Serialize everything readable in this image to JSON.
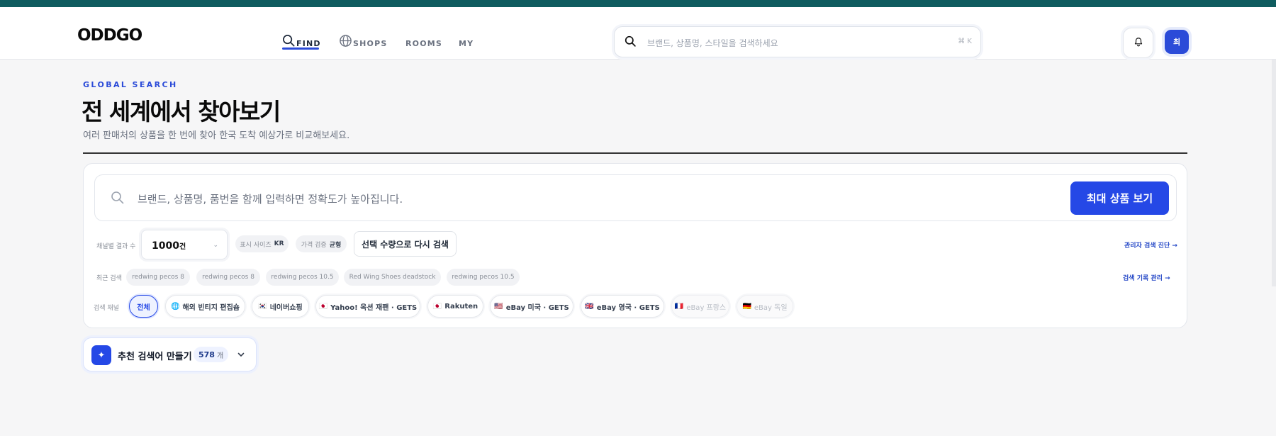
{
  "header": {
    "logo": "ODDGO",
    "nav": [
      {
        "label": "FIND",
        "icon": "search-icon",
        "active": true
      },
      {
        "label": "SHOPS",
        "icon": "globe-icon",
        "active": false
      },
      {
        "label": "ROOMS",
        "active": false
      },
      {
        "label": "MY",
        "active": false
      }
    ],
    "search_placeholder": "브랜드, 상품명, 스타일을 검색하세요",
    "search_shortcut": "⌘ K",
    "avatar_initial": "최"
  },
  "page": {
    "eyebrow": "GLOBAL SEARCH",
    "title": "전 세계에서 찾아보기",
    "subtitle": "여러 판매처의 상품을 한 번에 찾아 한국 도착 예상가로 비교해보세요."
  },
  "search_panel": {
    "placeholder": "브랜드, 상품명, 품번을 함께 입력하면 정확도가 높아집니다.",
    "submit_label": "최대 상품 보기",
    "results_per_channel_label": "채널별 결과 수",
    "results_per_channel_value": "1000",
    "results_per_channel_unit": "건",
    "display_size_label": "표시 사이즈",
    "display_size_value": "KR",
    "price_check_label": "가격 검증",
    "price_check_value": "균형",
    "research_label": "선택 수량으로 다시 검색",
    "admin_link": "관리자 검색 진단 →",
    "recent_label": "최근 검색",
    "recent_searches": [
      "redwing pecos 8",
      "redwing pecos 8",
      "redwing pecos 10.5",
      "Red Wing Shoes deadstock",
      "redwing pecos 10.5"
    ],
    "history_link": "검색 기록 관리 →",
    "channels_label": "검색 채널",
    "channels": [
      {
        "label": "전체",
        "flag": "",
        "state": "active"
      },
      {
        "label": "해외 빈티지 편집숍",
        "flag": "🌐",
        "state": "normal"
      },
      {
        "label": "네이버쇼핑",
        "flag": "🇰🇷",
        "state": "normal"
      },
      {
        "label": "Yahoo! 옥션 재팬 · GETS",
        "flag": "🇯🇵",
        "state": "normal"
      },
      {
        "label": "Rakuten",
        "flag": "🇯🇵",
        "state": "normal"
      },
      {
        "label": "eBay 미국 · GETS",
        "flag": "🇺🇸",
        "state": "normal"
      },
      {
        "label": "eBay 영국 · GETS",
        "flag": "🇬🇧",
        "state": "normal"
      },
      {
        "label": "eBay 프랑스",
        "flag": "🇫🇷",
        "state": "disabled"
      },
      {
        "label": "eBay 독일",
        "flag": "🇩🇪",
        "state": "disabled"
      }
    ]
  },
  "recommend": {
    "label": "추천 검색어 만들기",
    "count": "578",
    "count_unit": "개"
  },
  "colors": {
    "accent": "#2548e6",
    "top_strip": "#0f5c5f",
    "background": "#f6f6f7"
  }
}
